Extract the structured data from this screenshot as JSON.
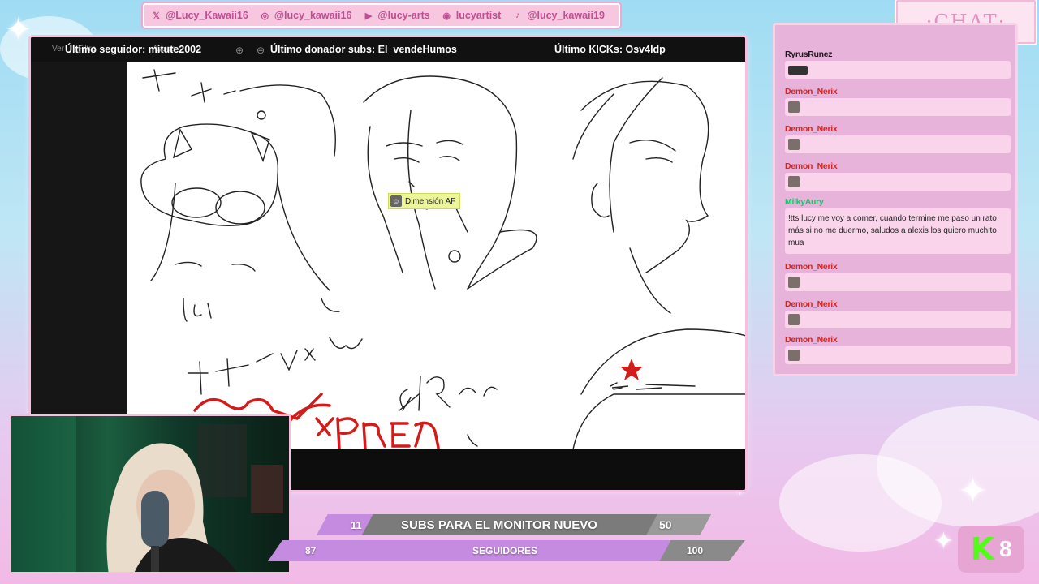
{
  "socials": [
    {
      "icon": "x-icon",
      "glyph": "𝕏",
      "handle": "@Lucy_Kawaii16"
    },
    {
      "icon": "instagram-icon",
      "glyph": "◎",
      "handle": "@lucy_kawaii16"
    },
    {
      "icon": "youtube-icon",
      "glyph": "▶",
      "handle": "@lucy-arts"
    },
    {
      "icon": "discord-icon",
      "glyph": "◉",
      "handle": "lucyartist"
    },
    {
      "icon": "tiktok-icon",
      "glyph": "♪",
      "handle": "@lucy_kawaii19"
    }
  ],
  "overlay": {
    "last_follower": "Último seguidor: mitute2002",
    "last_donor": "Último donador subs: El_vendeHumos",
    "last_kick": "Último KICKs: Osv4ldp"
  },
  "canvas": {
    "toolbar_ghost": [
      "Ver",
      "Filtro",
      "Ayuda"
    ],
    "stamp_label": "Dimensión AF"
  },
  "chat": {
    "title": "·CHAT·",
    "messages": [
      {
        "user": "RyrusRunez",
        "color": "#1a1a1a",
        "text": "",
        "emote": "wide"
      },
      {
        "user": "Demon_Nerix",
        "color": "#d9261c",
        "text": "",
        "emote": "square"
      },
      {
        "user": "Demon_Nerix",
        "color": "#d9261c",
        "text": "",
        "emote": "square"
      },
      {
        "user": "Demon_Nerix",
        "color": "#d9261c",
        "text": "",
        "emote": "square"
      },
      {
        "user": "MilkyAury",
        "color": "#19c46f",
        "text": "!tts lucy me voy a comer, cuando termine me paso un rato más si no me duermo, saludos a alexis los quiero muchito mua",
        "emote": ""
      },
      {
        "user": "Demon_Nerix",
        "color": "#d9261c",
        "text": "",
        "emote": "square"
      },
      {
        "user": "Demon_Nerix",
        "color": "#d9261c",
        "text": "",
        "emote": "square"
      },
      {
        "user": "Demon_Nerix",
        "color": "#d9261c",
        "text": "",
        "emote": "square"
      }
    ]
  },
  "goals": {
    "subs": {
      "current": "11",
      "label": "SUBS PARA EL MONITOR NUEVO",
      "target": "50",
      "progress": 0.22
    },
    "followers": {
      "current": "87",
      "label": "SEGUIDORES",
      "target": "100",
      "progress": 0.87
    }
  },
  "kick_badge": {
    "letter": "K",
    "count": "8"
  }
}
